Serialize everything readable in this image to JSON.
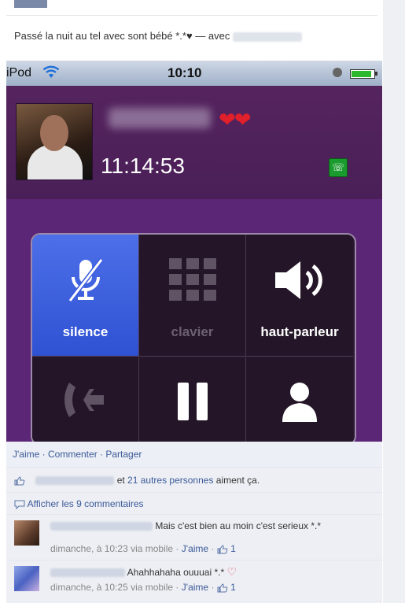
{
  "post": {
    "text": "Passé la nuit au tel avec sont bébé *.*♥ — avec"
  },
  "phone": {
    "carrier": "iPod",
    "time": "10:10",
    "call_timer": "11:14:53",
    "hearts": "❤❤",
    "keys": [
      {
        "label": "silence",
        "icon": "mic-muted-icon",
        "active": true
      },
      {
        "label": "clavier",
        "icon": "keypad-icon",
        "active": false
      },
      {
        "label": "haut-parleur",
        "icon": "speaker-icon",
        "active": false
      },
      {
        "label": "",
        "icon": "add-call-icon",
        "active": false
      },
      {
        "label": "",
        "icon": "pause-icon",
        "active": false
      },
      {
        "label": "",
        "icon": "contact-icon",
        "active": false
      }
    ],
    "colors": {
      "background": "#5c2676",
      "active_key": "#3b5ee0"
    }
  },
  "fb": {
    "actions": {
      "like": "J'aime",
      "comment": "Commenter",
      "share": "Partager",
      "sep": "·"
    },
    "likes": {
      "prefix": "et",
      "others": "21 autres personnes",
      "suffix": "aiment ça."
    },
    "show_comments": "Afficher les 9 commentaires",
    "comments": [
      {
        "text": "Mais c'est bien au moin c'est serieux *.*",
        "meta": "dimanche, à 10:23 via mobile ·",
        "like": "J'aime",
        "count": "1"
      },
      {
        "text": "Ahahhahaha ouuuai *.*",
        "meta": "dimanche, à 10:25 via mobile ·",
        "like": "J'aime",
        "count": "1"
      }
    ]
  },
  "colors": {
    "link": "#3b5998",
    "fb_bg": "#edeff4"
  }
}
